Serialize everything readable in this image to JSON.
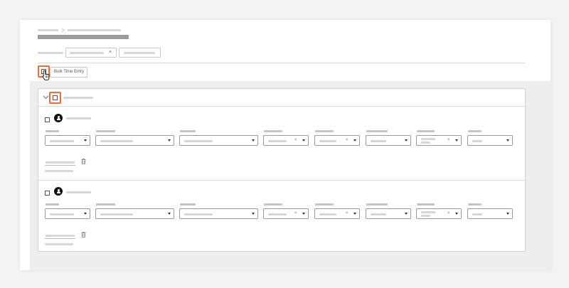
{
  "toolbar": {
    "bulk_time_entry_label": "Bulk Time Entry"
  },
  "filter": {
    "clear_symbol": "×"
  },
  "rows": [
    {
      "fields": [
        {
          "type": "select"
        },
        {
          "type": "select"
        },
        {
          "type": "select"
        },
        {
          "type": "select",
          "clearable": true
        },
        {
          "type": "select",
          "clearable": true
        },
        {
          "type": "select"
        },
        {
          "type": "select",
          "clearable": true
        },
        {
          "type": "select"
        }
      ],
      "clear_symbol": "×"
    },
    {
      "fields": [
        {
          "type": "select"
        },
        {
          "type": "select"
        },
        {
          "type": "select"
        },
        {
          "type": "select",
          "clearable": true
        },
        {
          "type": "select",
          "clearable": true
        },
        {
          "type": "select"
        },
        {
          "type": "select",
          "clearable": true
        },
        {
          "type": "select"
        }
      ],
      "clear_symbol": "×"
    }
  ],
  "colors": {
    "highlight": "#f26a3a",
    "placeholder": "#d6d6d6"
  },
  "icons": [
    "chevron-down-icon",
    "checkbox-icon",
    "avatar-icon",
    "trash-icon",
    "cursor-hand-icon",
    "dropdown-arrow-icon",
    "clear-x-icon"
  ]
}
